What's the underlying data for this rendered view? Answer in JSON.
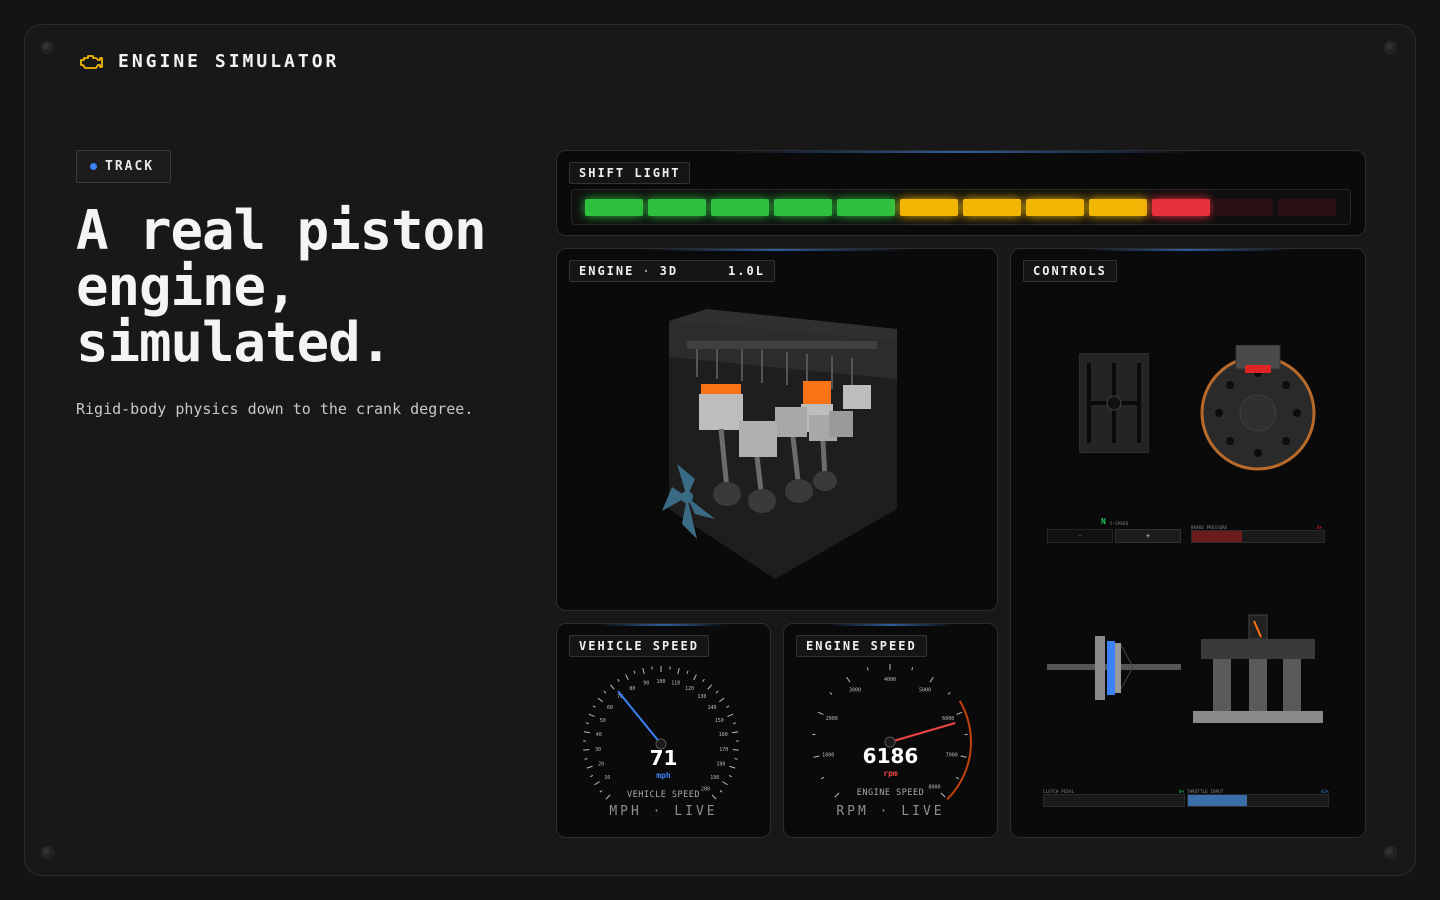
{
  "app": {
    "title": "ENGINE SIMULATOR",
    "icon": "engine-check-icon"
  },
  "badge": {
    "label": "TRACK",
    "dot_color": "#3b82f6"
  },
  "hero": {
    "title": "A real piston engine, simulated.",
    "subtitle": "Rigid-body physics down to the crank degree."
  },
  "shift_light": {
    "label": "SHIFT LIGHT",
    "leds": [
      {
        "color": "#2fbf3f",
        "on": true
      },
      {
        "color": "#2fbf3f",
        "on": true
      },
      {
        "color": "#2fbf3f",
        "on": true
      },
      {
        "color": "#2fbf3f",
        "on": true
      },
      {
        "color": "#2fbf3f",
        "on": true
      },
      {
        "color": "#f2b705",
        "on": true
      },
      {
        "color": "#f2b705",
        "on": true
      },
      {
        "color": "#f2b705",
        "on": true
      },
      {
        "color": "#f2b705",
        "on": true
      },
      {
        "color": "#e8313a",
        "on": true
      },
      {
        "color": "#e8313a",
        "on": false
      },
      {
        "color": "#e8313a",
        "on": false
      }
    ]
  },
  "engine_view": {
    "label": "ENGINE",
    "mode": "3D",
    "displacement": "1.0L"
  },
  "controls": {
    "label": "CONTROLS",
    "gear": {
      "current": "N",
      "caption": "5-SPEED",
      "minus": "−",
      "plus": "+"
    },
    "brake": {
      "caption": "BRAKE PRESSURE",
      "value": "0%",
      "fraction": 0.38
    },
    "clutch": {
      "caption": "CLUTCH PEDAL",
      "value": "0%",
      "fraction": 0.0
    },
    "throttle": {
      "caption": "THROTTLE INPUT",
      "value": "42%",
      "fraction": 0.42
    }
  },
  "vehicle_speed": {
    "label": "VEHICLE SPEED",
    "value": "71",
    "unit": "mph",
    "caption": "VEHICLE SPEED",
    "footer_unit": "MPH",
    "footer_status": "LIVE",
    "max": 200,
    "ticks": [
      "10",
      "20",
      "30",
      "40",
      "50",
      "60",
      "70",
      "80",
      "90",
      "100",
      "110",
      "120",
      "130",
      "140",
      "150",
      "160",
      "170",
      "180",
      "190",
      "200"
    ],
    "accent": "#3b82f6"
  },
  "engine_speed": {
    "label": "ENGINE SPEED",
    "value": "6186",
    "unit": "rpm",
    "caption": "ENGINE SPEED",
    "footer_unit": "RPM",
    "footer_status": "LIVE",
    "max": 8000,
    "ticks": [
      "1000",
      "2000",
      "3000",
      "4000",
      "5000",
      "6000",
      "7000",
      "8000"
    ],
    "accent": "#ef4444"
  }
}
